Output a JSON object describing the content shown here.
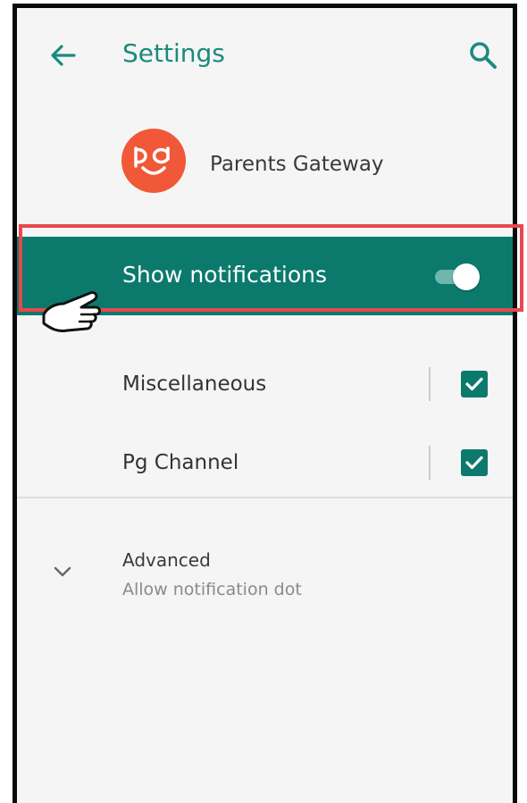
{
  "appbar": {
    "title": "Settings",
    "back_icon": "arrow-left-icon",
    "search_icon": "search-icon"
  },
  "app": {
    "name": "Parents Gateway",
    "logo_text": "pg",
    "logo_color": "#f05838"
  },
  "notifications": {
    "label": "Show notifications",
    "enabled": true
  },
  "channels": [
    {
      "label": "Miscellaneous",
      "checked": true
    },
    {
      "label": "Pg Channel",
      "checked": true
    }
  ],
  "advanced": {
    "title": "Advanced",
    "subtitle": "Allow notification dot"
  },
  "colors": {
    "accent": "#1b8a7c",
    "row_highlight": "#0b7a6c",
    "annotation_border": "#e8484d"
  }
}
